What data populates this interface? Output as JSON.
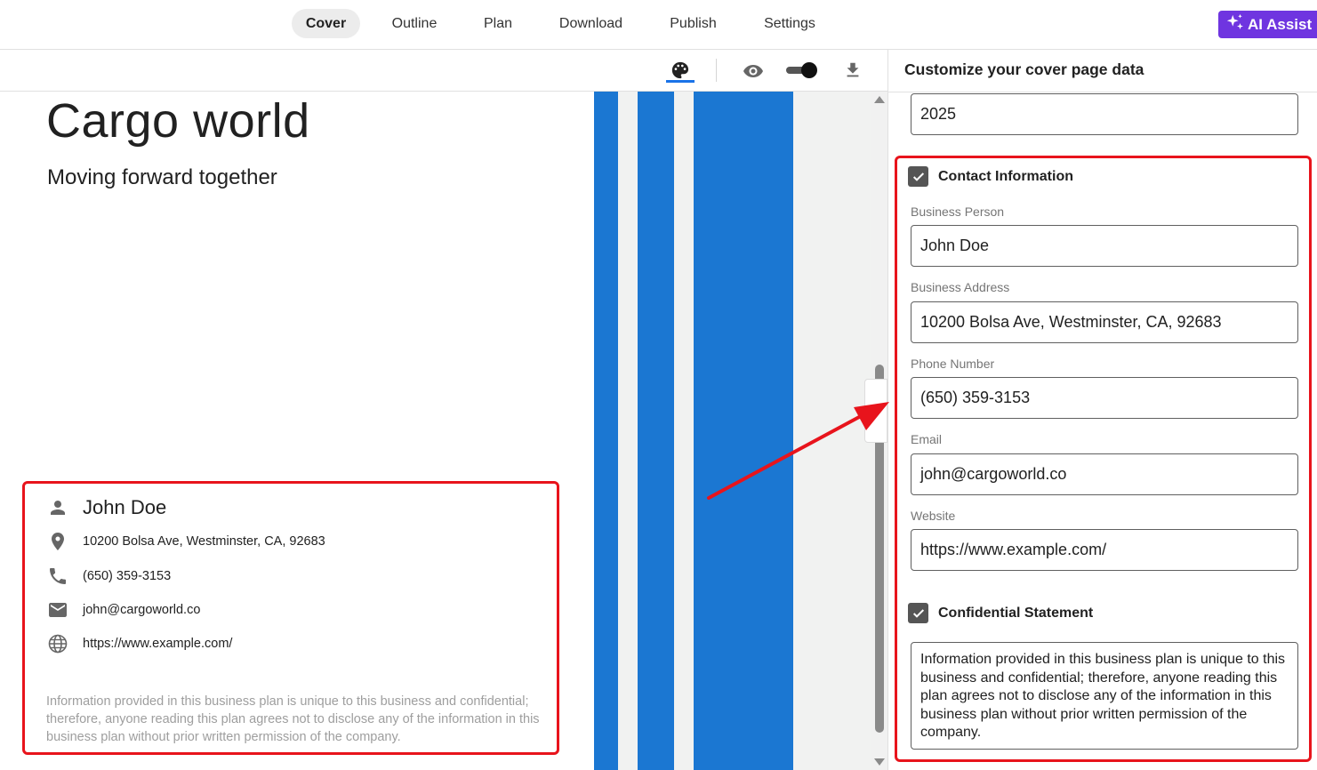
{
  "nav": {
    "tabs": [
      {
        "label": "Cover",
        "active": true
      },
      {
        "label": "Outline"
      },
      {
        "label": "Plan"
      },
      {
        "label": "Download"
      },
      {
        "label": "Publish"
      },
      {
        "label": "Settings"
      }
    ],
    "ai_button": "AI Assist"
  },
  "toolbar": {
    "icons": [
      "palette-icon",
      "eye-icon",
      "toggle",
      "download-icon"
    ]
  },
  "cover": {
    "title": "Cargo world",
    "subtitle": "Moving forward together",
    "contact": {
      "name": "John Doe",
      "address": "10200 Bolsa Ave, Westminster, CA, 92683",
      "phone": "(650) 359-3153",
      "email": "john@cargoworld.co",
      "website": "https://www.example.com/"
    },
    "confidential": "Information provided in this business plan is unique to this business and confidential; therefore, anyone reading this plan agrees not to disclose any of the information in this business plan without prior written permission of the company."
  },
  "panel": {
    "header": "Customize your cover page data",
    "year_value": "2025",
    "contact_section": {
      "label": "Contact Information",
      "checked": true,
      "fields": {
        "business_person": {
          "label": "Business Person",
          "value": "John Doe"
        },
        "business_address": {
          "label": "Business Address",
          "value": "10200 Bolsa Ave, Westminster, CA, 92683"
        },
        "phone": {
          "label": "Phone Number",
          "value": "(650) 359-3153"
        },
        "email": {
          "label": "Email",
          "value": "john@cargoworld.co"
        },
        "website": {
          "label": "Website",
          "value": "https://www.example.com/"
        }
      }
    },
    "confidential_section": {
      "label": "Confidential Statement",
      "checked": true,
      "text": "Information provided in this business plan is unique to this business and confidential; therefore, anyone reading this plan agrees not to disclose any of the information in this business plan without prior written permission of the company."
    }
  },
  "colors": {
    "accent": "#6f35e0",
    "stripe": "#1b77d2",
    "highlight": "#e8141c",
    "active_underline": "#1a73e8"
  }
}
